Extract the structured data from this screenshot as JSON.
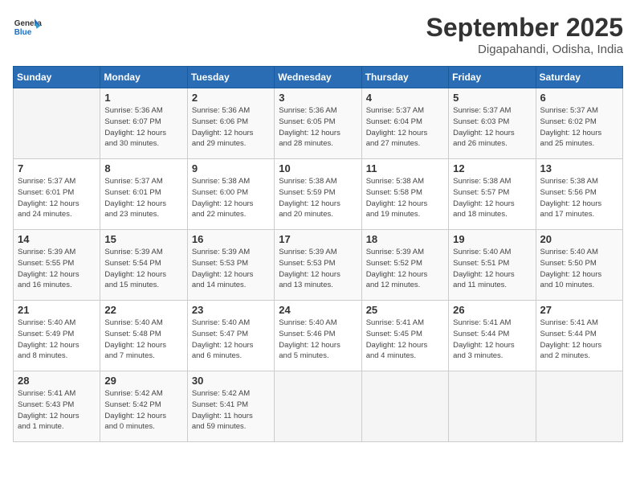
{
  "header": {
    "logo_general": "General",
    "logo_blue": "Blue",
    "title": "September 2025",
    "location": "Digapahandi, Odisha, India"
  },
  "days_of_week": [
    "Sunday",
    "Monday",
    "Tuesday",
    "Wednesday",
    "Thursday",
    "Friday",
    "Saturday"
  ],
  "weeks": [
    [
      {
        "day": "",
        "info": ""
      },
      {
        "day": "1",
        "info": "Sunrise: 5:36 AM\nSunset: 6:07 PM\nDaylight: 12 hours\nand 30 minutes."
      },
      {
        "day": "2",
        "info": "Sunrise: 5:36 AM\nSunset: 6:06 PM\nDaylight: 12 hours\nand 29 minutes."
      },
      {
        "day": "3",
        "info": "Sunrise: 5:36 AM\nSunset: 6:05 PM\nDaylight: 12 hours\nand 28 minutes."
      },
      {
        "day": "4",
        "info": "Sunrise: 5:37 AM\nSunset: 6:04 PM\nDaylight: 12 hours\nand 27 minutes."
      },
      {
        "day": "5",
        "info": "Sunrise: 5:37 AM\nSunset: 6:03 PM\nDaylight: 12 hours\nand 26 minutes."
      },
      {
        "day": "6",
        "info": "Sunrise: 5:37 AM\nSunset: 6:02 PM\nDaylight: 12 hours\nand 25 minutes."
      }
    ],
    [
      {
        "day": "7",
        "info": "Sunrise: 5:37 AM\nSunset: 6:01 PM\nDaylight: 12 hours\nand 24 minutes."
      },
      {
        "day": "8",
        "info": "Sunrise: 5:37 AM\nSunset: 6:01 PM\nDaylight: 12 hours\nand 23 minutes."
      },
      {
        "day": "9",
        "info": "Sunrise: 5:38 AM\nSunset: 6:00 PM\nDaylight: 12 hours\nand 22 minutes."
      },
      {
        "day": "10",
        "info": "Sunrise: 5:38 AM\nSunset: 5:59 PM\nDaylight: 12 hours\nand 20 minutes."
      },
      {
        "day": "11",
        "info": "Sunrise: 5:38 AM\nSunset: 5:58 PM\nDaylight: 12 hours\nand 19 minutes."
      },
      {
        "day": "12",
        "info": "Sunrise: 5:38 AM\nSunset: 5:57 PM\nDaylight: 12 hours\nand 18 minutes."
      },
      {
        "day": "13",
        "info": "Sunrise: 5:38 AM\nSunset: 5:56 PM\nDaylight: 12 hours\nand 17 minutes."
      }
    ],
    [
      {
        "day": "14",
        "info": "Sunrise: 5:39 AM\nSunset: 5:55 PM\nDaylight: 12 hours\nand 16 minutes."
      },
      {
        "day": "15",
        "info": "Sunrise: 5:39 AM\nSunset: 5:54 PM\nDaylight: 12 hours\nand 15 minutes."
      },
      {
        "day": "16",
        "info": "Sunrise: 5:39 AM\nSunset: 5:53 PM\nDaylight: 12 hours\nand 14 minutes."
      },
      {
        "day": "17",
        "info": "Sunrise: 5:39 AM\nSunset: 5:53 PM\nDaylight: 12 hours\nand 13 minutes."
      },
      {
        "day": "18",
        "info": "Sunrise: 5:39 AM\nSunset: 5:52 PM\nDaylight: 12 hours\nand 12 minutes."
      },
      {
        "day": "19",
        "info": "Sunrise: 5:40 AM\nSunset: 5:51 PM\nDaylight: 12 hours\nand 11 minutes."
      },
      {
        "day": "20",
        "info": "Sunrise: 5:40 AM\nSunset: 5:50 PM\nDaylight: 12 hours\nand 10 minutes."
      }
    ],
    [
      {
        "day": "21",
        "info": "Sunrise: 5:40 AM\nSunset: 5:49 PM\nDaylight: 12 hours\nand 8 minutes."
      },
      {
        "day": "22",
        "info": "Sunrise: 5:40 AM\nSunset: 5:48 PM\nDaylight: 12 hours\nand 7 minutes."
      },
      {
        "day": "23",
        "info": "Sunrise: 5:40 AM\nSunset: 5:47 PM\nDaylight: 12 hours\nand 6 minutes."
      },
      {
        "day": "24",
        "info": "Sunrise: 5:40 AM\nSunset: 5:46 PM\nDaylight: 12 hours\nand 5 minutes."
      },
      {
        "day": "25",
        "info": "Sunrise: 5:41 AM\nSunset: 5:45 PM\nDaylight: 12 hours\nand 4 minutes."
      },
      {
        "day": "26",
        "info": "Sunrise: 5:41 AM\nSunset: 5:44 PM\nDaylight: 12 hours\nand 3 minutes."
      },
      {
        "day": "27",
        "info": "Sunrise: 5:41 AM\nSunset: 5:44 PM\nDaylight: 12 hours\nand 2 minutes."
      }
    ],
    [
      {
        "day": "28",
        "info": "Sunrise: 5:41 AM\nSunset: 5:43 PM\nDaylight: 12 hours\nand 1 minute."
      },
      {
        "day": "29",
        "info": "Sunrise: 5:42 AM\nSunset: 5:42 PM\nDaylight: 12 hours\nand 0 minutes."
      },
      {
        "day": "30",
        "info": "Sunrise: 5:42 AM\nSunset: 5:41 PM\nDaylight: 11 hours\nand 59 minutes."
      },
      {
        "day": "",
        "info": ""
      },
      {
        "day": "",
        "info": ""
      },
      {
        "day": "",
        "info": ""
      },
      {
        "day": "",
        "info": ""
      }
    ]
  ]
}
